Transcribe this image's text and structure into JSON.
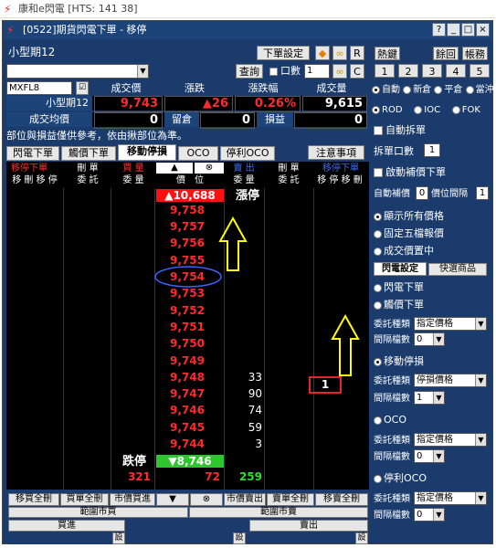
{
  "app_title": "康和e閃電 [HTS: 141 38]",
  "window_title": "[0522]期貨閃電下單 - 移停",
  "product_name": "小型期12",
  "toolbar": {
    "order_settings": "下單設定",
    "r_btn": "R",
    "c_btn": "C",
    "query": "查詢",
    "count_label": "口數",
    "count_value": "1"
  },
  "right_top": {
    "hotkey": "熱鍵",
    "return_report": "餘回",
    "account": "帳務",
    "nums": [
      "1",
      "2",
      "3",
      "4",
      "5"
    ]
  },
  "quote": {
    "symbol": "MXFL8",
    "headers": [
      "成交價",
      "漲跌",
      "漲跌幅",
      "成交量"
    ],
    "name": "小型期12",
    "price": "9,743",
    "change": "▲26",
    "pct": "0.26%",
    "volume": "9,615",
    "avg_label": "成交均價",
    "avg_value": "0",
    "pos_label": "留倉",
    "pos_value": "0",
    "pnl_label": "損益",
    "pnl_value": "0"
  },
  "note": "部位與損益僅供參考，依由揪部位為準。",
  "tabs": [
    "閃電下單",
    "觸價下單",
    "移動停損",
    "OCO",
    "停利OCO"
  ],
  "notice_btn": "注意事項",
  "col_headers": {
    "buy_stop": "移停下單",
    "buy_stop_sub": "移 刪 移 停",
    "cancel_order": "刪 單",
    "cancel_sub": "委 託",
    "bid": "買 量",
    "bid_sub": "委 量",
    "up": "▲",
    "up_sub": "價　位",
    "x": "⊗",
    "ask_label": "賣 出",
    "ask_sub": "委 量",
    "cancel2": "刪 單",
    "cancel2_sub": "委 託",
    "sell_stop": "移停下單",
    "sell_stop_sub": "移 停 移 刪"
  },
  "limit_up_price": "▲10,688",
  "limit_up_label": "漲停",
  "limit_down_label": "跌停",
  "limit_down_price": "▼8,746",
  "ladder": [
    {
      "price": "9,758",
      "qty": ""
    },
    {
      "price": "9,757",
      "qty": ""
    },
    {
      "price": "9,756",
      "qty": ""
    },
    {
      "price": "9,755",
      "qty": ""
    },
    {
      "price": "9,754",
      "qty": ""
    },
    {
      "price": "9,753",
      "qty": ""
    },
    {
      "price": "9,752",
      "qty": ""
    },
    {
      "price": "9,751",
      "qty": ""
    },
    {
      "price": "9,750",
      "qty": ""
    },
    {
      "price": "9,749",
      "qty": ""
    },
    {
      "price": "9,748",
      "qty": "33"
    },
    {
      "price": "9,747",
      "qty": "90"
    },
    {
      "price": "9,746",
      "qty": "74"
    },
    {
      "price": "9,745",
      "qty": "59"
    },
    {
      "price": "9,744",
      "qty": "3"
    }
  ],
  "sell_stop_qty": "1",
  "totals": {
    "bid_left": "321",
    "bid_right": "72",
    "ask": "259"
  },
  "bottom_buttons": [
    "移買全刪",
    "買單全刪",
    "市價買進",
    "▼",
    "⊗",
    "市價賣出",
    "賣單全刪",
    "移賣全刪"
  ],
  "range_buy": "範圍市買",
  "range_sell": "範圍市賣",
  "buy_label": "買進",
  "sell_label": "賣出",
  "set_label": "設",
  "right_panel": {
    "radios1": [
      "自動",
      "新倉",
      "平倉",
      "當沖"
    ],
    "radios2": [
      "ROD",
      "IOC",
      "FOK"
    ],
    "auto_split": "自動拆單",
    "split_label": "拆單口數",
    "split_value": "1",
    "trigger_order": "啟動補價下單",
    "auto_fill": "自動補價",
    "auto_fill_value": "0",
    "interval_label": "價位間隔",
    "interval_value": "1",
    "show_all": "顯示所有價格",
    "fixed_five": "固定五檔報價",
    "center": "成交價置中",
    "sub_tabs": [
      "閃電設定",
      "快選商品"
    ],
    "flash_order": "閃電下單",
    "trigger_price": "觸價下單",
    "type_label": "委託種類",
    "type_values": [
      "指定價格",
      "停損價格",
      "指定價格",
      "指定價格"
    ],
    "gap_label": "間隔檔數",
    "gap_values": [
      "0",
      "1",
      "0",
      "0"
    ],
    "move_stop": "移動停損",
    "oco": "OCO",
    "profit_oco": "停利OCO"
  }
}
